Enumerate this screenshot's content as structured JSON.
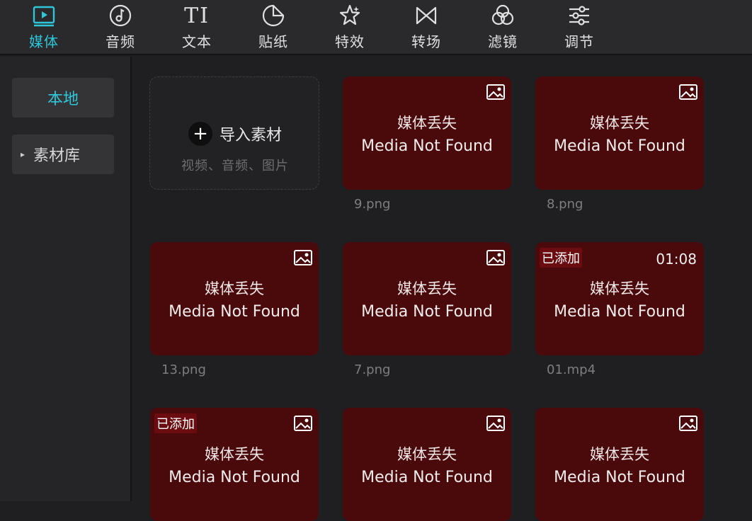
{
  "toolbar": {
    "tabs": [
      {
        "label": "媒体",
        "icon": "media-icon",
        "active": true
      },
      {
        "label": "音频",
        "icon": "audio-icon",
        "active": false
      },
      {
        "label": "文本",
        "icon": "text-icon",
        "active": false
      },
      {
        "label": "贴纸",
        "icon": "sticker-icon",
        "active": false
      },
      {
        "label": "特效",
        "icon": "effects-icon",
        "active": false
      },
      {
        "label": "转场",
        "icon": "transition-icon",
        "active": false
      },
      {
        "label": "滤镜",
        "icon": "filter-icon",
        "active": false
      },
      {
        "label": "调节",
        "icon": "adjust-icon",
        "active": false
      }
    ],
    "text_icon_glyph": "TI"
  },
  "sidebar": {
    "items": [
      {
        "label": "本地",
        "active": true
      },
      {
        "label": "素材库",
        "active": false,
        "arrow": "▸"
      }
    ]
  },
  "import": {
    "plus": "+",
    "label": "导入素材",
    "subtitle": "视频、音频、图片"
  },
  "media": [
    {
      "zh": "媒体丢失",
      "en": "Media Not Found",
      "file": "9.png",
      "badge": "",
      "duration": "",
      "icon": "image-icon"
    },
    {
      "zh": "媒体丢失",
      "en": "Media Not Found",
      "file": "8.png",
      "badge": "",
      "duration": "",
      "icon": "image-icon"
    },
    {
      "zh": "媒体丢失",
      "en": "Media Not Found",
      "file": "13.png",
      "badge": "",
      "duration": "",
      "icon": "image-icon"
    },
    {
      "zh": "媒体丢失",
      "en": "Media Not Found",
      "file": "7.png",
      "badge": "",
      "duration": "",
      "icon": "image-icon"
    },
    {
      "zh": "媒体丢失",
      "en": "Media Not Found",
      "file": "01.mp4",
      "badge": "已添加",
      "duration": "01:08",
      "icon": ""
    },
    {
      "zh": "媒体丢失",
      "en": "Media Not Found",
      "file": "",
      "badge": "已添加",
      "duration": "",
      "icon": "image-icon"
    },
    {
      "zh": "媒体丢失",
      "en": "Media Not Found",
      "file": "",
      "badge": "",
      "duration": "",
      "icon": "image-icon"
    },
    {
      "zh": "媒体丢失",
      "en": "Media Not Found",
      "file": "",
      "badge": "",
      "duration": "",
      "icon": "image-icon"
    }
  ],
  "colors": {
    "accent": "#2ec7d9",
    "missing_card": "#4a0a0b",
    "badge": "#6b0d10"
  }
}
